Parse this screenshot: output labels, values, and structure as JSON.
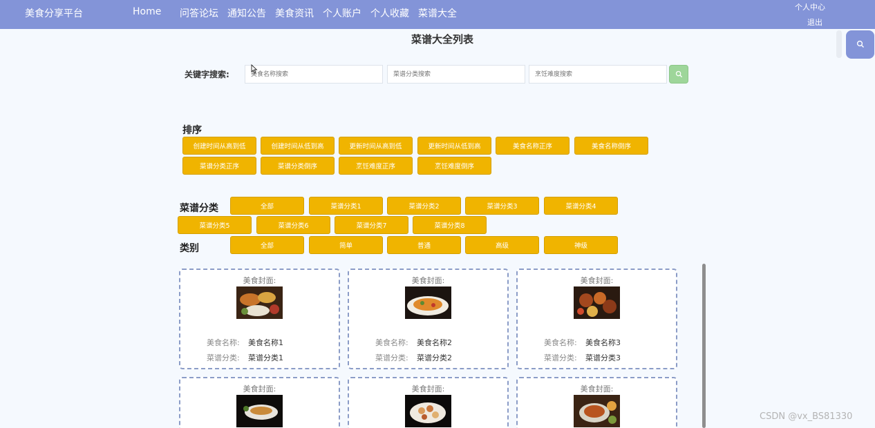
{
  "header": {
    "brand": "美食分享平台",
    "home": "Home",
    "nav": [
      "问答论坛",
      "通知公告",
      "美食资讯",
      "个人账户",
      "个人收藏",
      "菜谱大全"
    ],
    "user_center": "个人中心",
    "logout": "退出"
  },
  "page_title": "菜谱大全列表",
  "search": {
    "label": "关键字搜索:",
    "name_placeholder": "美食名称搜索",
    "category_placeholder": "菜谱分类搜索",
    "difficulty_placeholder": "烹饪难度搜索"
  },
  "sort": {
    "label": "排序",
    "options": [
      "创建时间从高到低",
      "创建时间从低到高",
      "更新时间从高到低",
      "更新时间从低到高",
      "美食名称正序",
      "美食名称倒序",
      "菜谱分类正序",
      "菜谱分类倒序",
      "烹饪难度正序",
      "烹饪难度倒序"
    ]
  },
  "category": {
    "label": "菜谱分类",
    "options": [
      "全部",
      "菜谱分类1",
      "菜谱分类2",
      "菜谱分类3",
      "菜谱分类4",
      "菜谱分类5",
      "菜谱分类6",
      "菜谱分类7",
      "菜谱分类8"
    ]
  },
  "level": {
    "label": "类别",
    "options": [
      "全部",
      "简单",
      "普通",
      "高级",
      "神级"
    ]
  },
  "card_labels": {
    "cover": "美食封面:",
    "name": "美食名称:",
    "category": "菜谱分类:"
  },
  "cards": [
    {
      "name": "美食名称1",
      "category": "菜谱分类1"
    },
    {
      "name": "美食名称2",
      "category": "菜谱分类2"
    },
    {
      "name": "美食名称3",
      "category": "菜谱分类3"
    },
    {},
    {},
    {}
  ],
  "watermark": "CSDN @vx_BS81330",
  "colors": {
    "header": "#8394d8",
    "button": "#f0b400",
    "search_button": "#9ed69a",
    "card_border": "#8b9cc7"
  },
  "icons": {
    "search_button": "search-icon",
    "side_search": "search-icon"
  }
}
